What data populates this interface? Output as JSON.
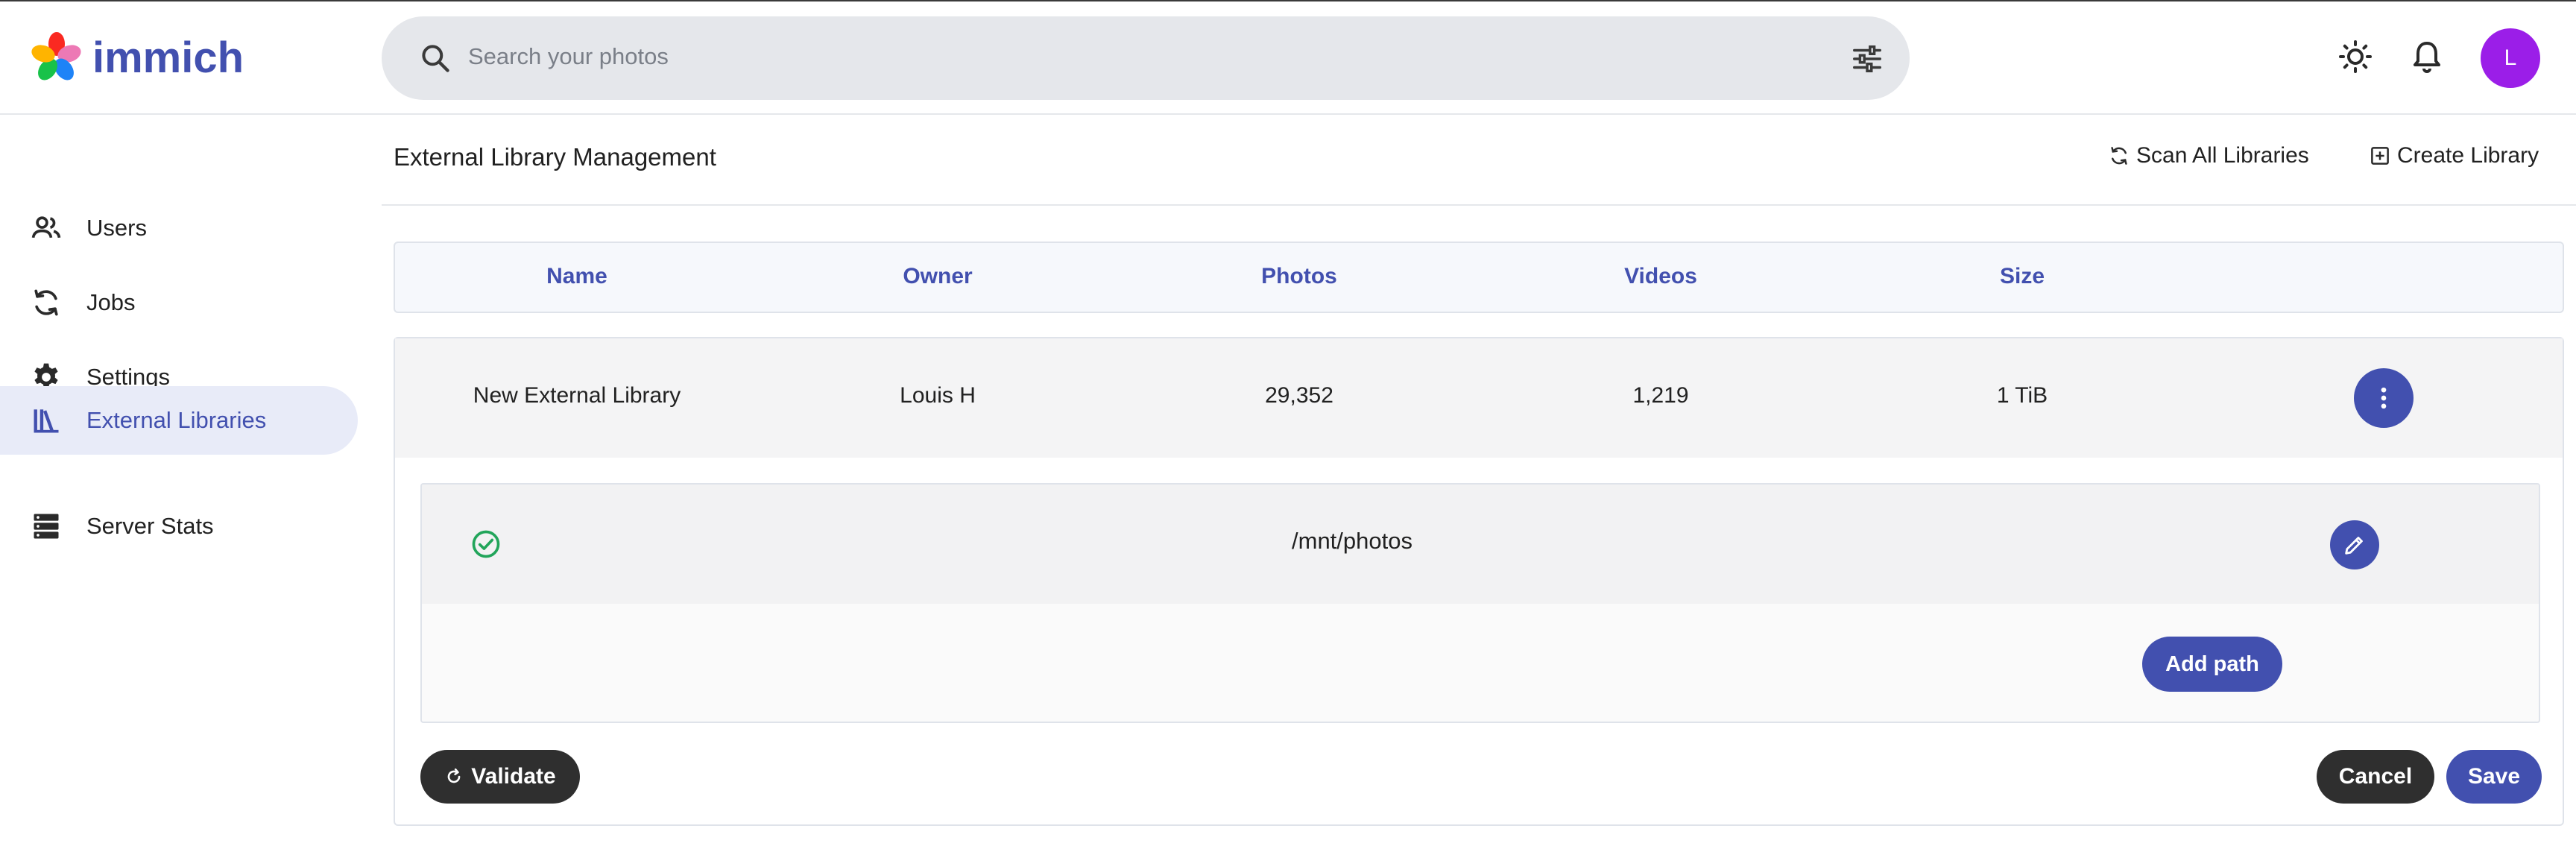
{
  "app": {
    "logo_text": "immich"
  },
  "search": {
    "placeholder": "Search your photos"
  },
  "user": {
    "avatar_initial": "L",
    "avatar_color": "#9b1ee8"
  },
  "theme": {
    "primary": "#4250af",
    "dark_button": "#2f2f2f",
    "success": "#22a55a"
  },
  "sidebar": {
    "items": [
      {
        "label": "Users",
        "icon": "users-icon",
        "active": false
      },
      {
        "label": "Jobs",
        "icon": "sync-icon",
        "active": false
      },
      {
        "label": "Settings",
        "icon": "gear-icon",
        "active": false
      },
      {
        "label": "External Libraries",
        "icon": "library-icon",
        "active": true
      },
      {
        "label": "Server Stats",
        "icon": "server-icon",
        "active": false
      }
    ]
  },
  "page": {
    "title": "External Library Management",
    "scan_all_label": "Scan All Libraries",
    "create_label": "Create Library"
  },
  "table": {
    "headers": [
      "Name",
      "Owner",
      "Photos",
      "Videos",
      "Size"
    ],
    "rows": [
      {
        "name": "New External Library",
        "owner": "Louis H",
        "photos": "29,352",
        "videos": "1,219",
        "size": "1 TiB"
      }
    ]
  },
  "library_editor": {
    "paths": [
      {
        "path": "/mnt/photos",
        "status": "valid"
      }
    ],
    "add_path_label": "Add path",
    "validate_label": "Validate",
    "cancel_label": "Cancel",
    "save_label": "Save"
  }
}
